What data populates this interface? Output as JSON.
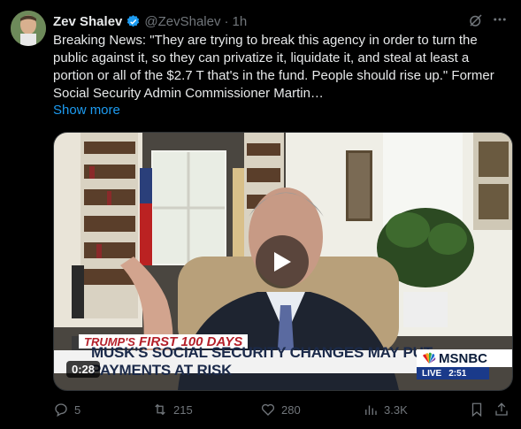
{
  "author": {
    "name": "Zev Shalev",
    "handle": "@ZevShalev",
    "separator": "·",
    "time": "1h"
  },
  "post": {
    "text": "Breaking News: \"They are trying to break this agency in order to turn the public against it, so they can privatize it, liquidate it, and steal at least a portion or all of the $2.7 T that's in the fund. People should rise up.\" Former Social Security Admin Commissioner Martin…",
    "show_more": "Show more"
  },
  "video": {
    "duration": "0:28",
    "banner_top_prefix": "TRUMP'S",
    "banner_top_highlight": "FIRST 100 DAYS",
    "banner_headline": "MUSK'S SOCIAL SECURITY CHANGES MAY PUT PAYMENTS AT RISK",
    "network": "MSNBC",
    "live_label": "LIVE",
    "live_time": "2:51"
  },
  "actions": {
    "replies": "5",
    "reposts": "215",
    "likes": "280",
    "views": "3.3K"
  },
  "colors": {
    "link": "#1d9bf0",
    "muted": "#71767b",
    "verified": "#1d9bf0"
  }
}
